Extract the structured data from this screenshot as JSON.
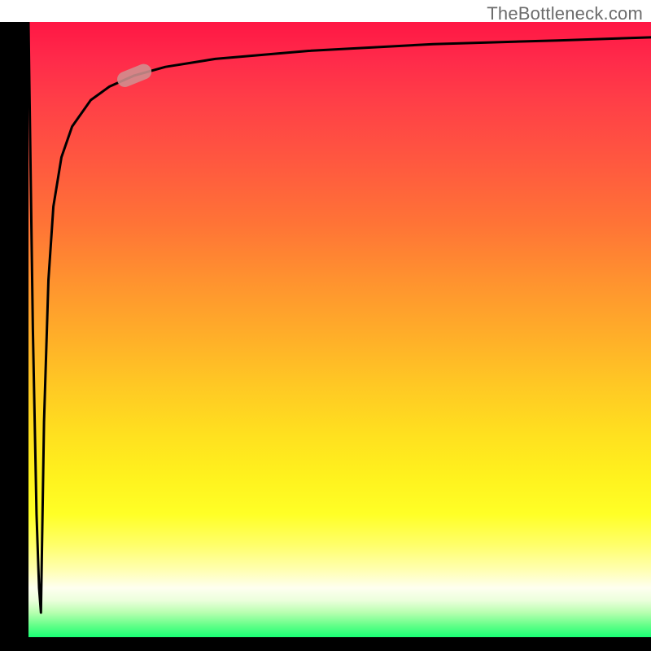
{
  "watermark": "TheBottleneck.com",
  "colors": {
    "axis": "#000000",
    "curve": "#000000",
    "marker": "#d09090",
    "gradient_top": "#ff1744",
    "gradient_mid": "#ffff26",
    "gradient_bottom": "#18ff74"
  },
  "chart_data": {
    "type": "line",
    "title": "",
    "xlabel": "",
    "ylabel": "",
    "xlim": [
      0,
      100
    ],
    "ylim": [
      0,
      100
    ],
    "grid": false,
    "series": [
      {
        "name": "curve",
        "x": [
          0,
          0.7,
          1.3,
          1.7,
          2.0,
          2.5,
          3.2,
          4.0,
          5.3,
          7.0,
          10.0,
          13.0,
          17.0,
          22.0,
          30.0,
          45.0,
          65.0,
          85.0,
          100.0
        ],
        "values": [
          100,
          50,
          20,
          8,
          4,
          35,
          58,
          70,
          78,
          83,
          87.3,
          89.5,
          91.3,
          92.7,
          94.0,
          95.3,
          96.4,
          97.0,
          97.5
        ]
      }
    ],
    "marker": {
      "x": 17.0,
      "y": 91.3,
      "angle_deg": 22
    },
    "background_gradient": {
      "direction": "vertical",
      "stops": [
        {
          "pos": 0.0,
          "color": "#ff1744"
        },
        {
          "pos": 0.45,
          "color": "#ff922f"
        },
        {
          "pos": 0.8,
          "color": "#ffff26"
        },
        {
          "pos": 0.93,
          "color": "#fefff0"
        },
        {
          "pos": 1.0,
          "color": "#18ff74"
        }
      ]
    }
  }
}
